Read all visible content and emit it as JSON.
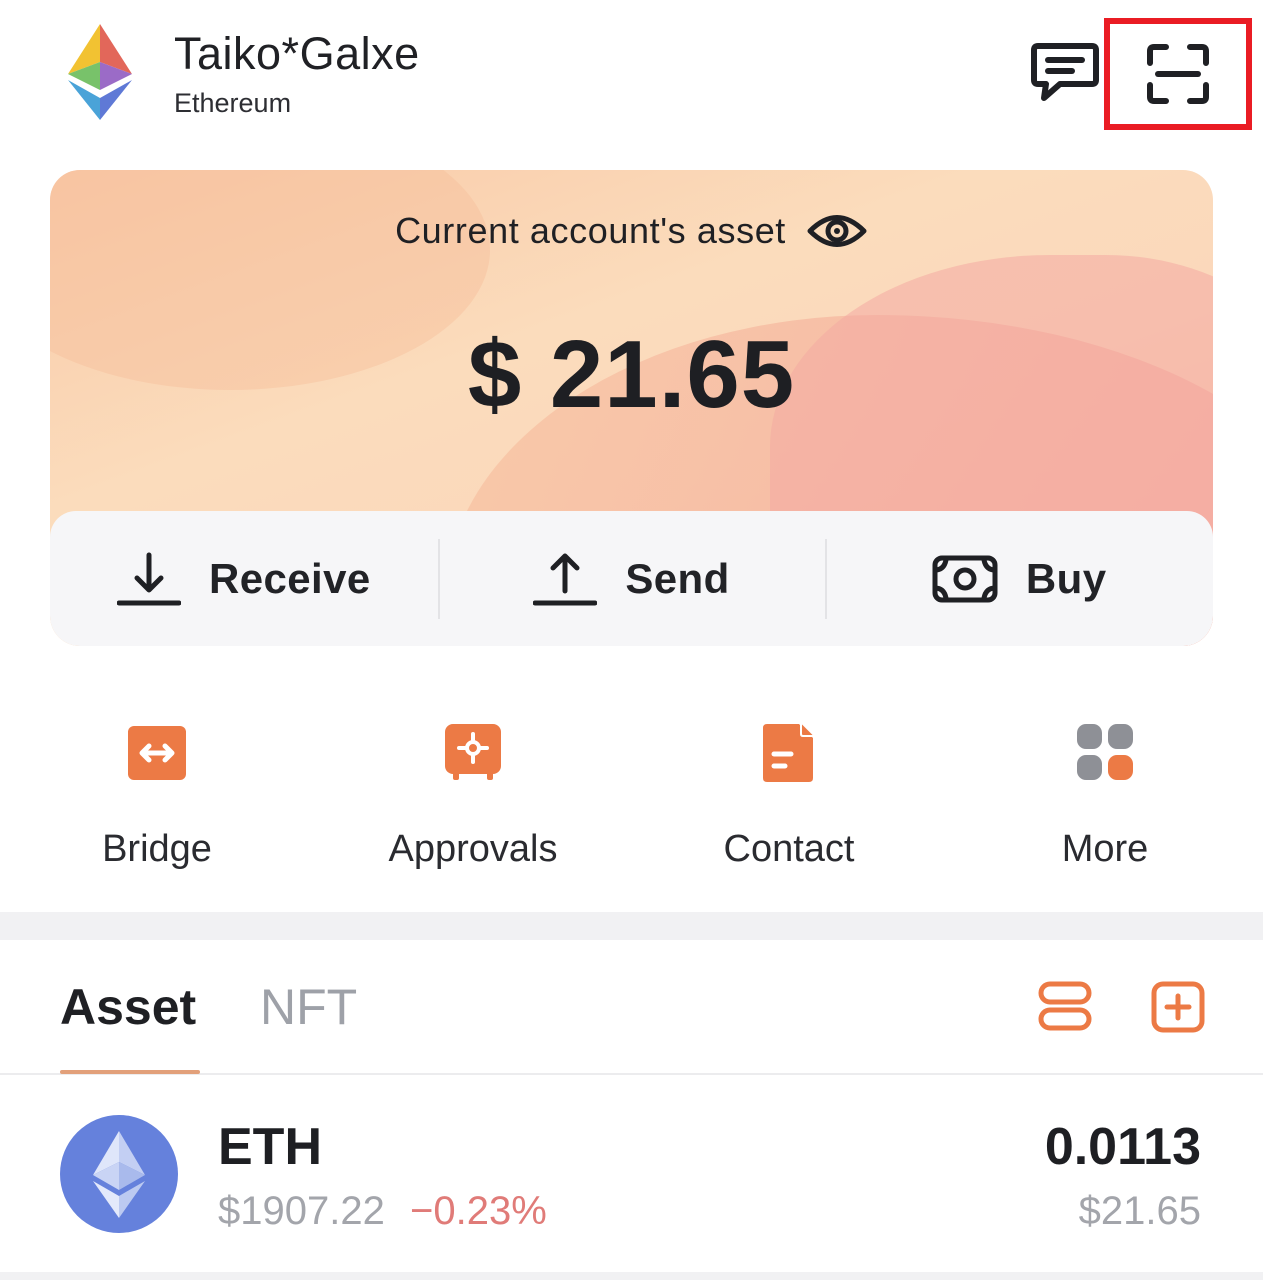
{
  "header": {
    "wallet_name": "Taiko*Galxe",
    "network": "Ethereum",
    "icons": {
      "wallet_logo": "ethereum-rainbow-logo-icon",
      "messages": "chat-bubble-icon",
      "scan": "scan-icon"
    },
    "highlight_color": "#ea1c24"
  },
  "asset_card": {
    "label": "Current account's asset",
    "balance": "$ 21.65",
    "eye_icon": "eye-icon",
    "actions": [
      {
        "label": "Receive",
        "icon": "download-arrow-icon"
      },
      {
        "label": "Send",
        "icon": "upload-arrow-icon"
      },
      {
        "label": "Buy",
        "icon": "cash-icon"
      }
    ]
  },
  "quick_actions": [
    {
      "label": "Bridge",
      "icon": "bridge-icon"
    },
    {
      "label": "Approvals",
      "icon": "approvals-icon"
    },
    {
      "label": "Contact",
      "icon": "contact-icon"
    },
    {
      "label": "More",
      "icon": "more-grid-icon"
    }
  ],
  "accent_color": "#ec7a45",
  "tabs": {
    "asset": "Asset",
    "nft": "NFT",
    "active": "Asset"
  },
  "tokens": [
    {
      "symbol": "ETH",
      "price": "$1907.22",
      "change": "−0.23%",
      "amount": "0.0113",
      "value": "$21.65"
    }
  ]
}
